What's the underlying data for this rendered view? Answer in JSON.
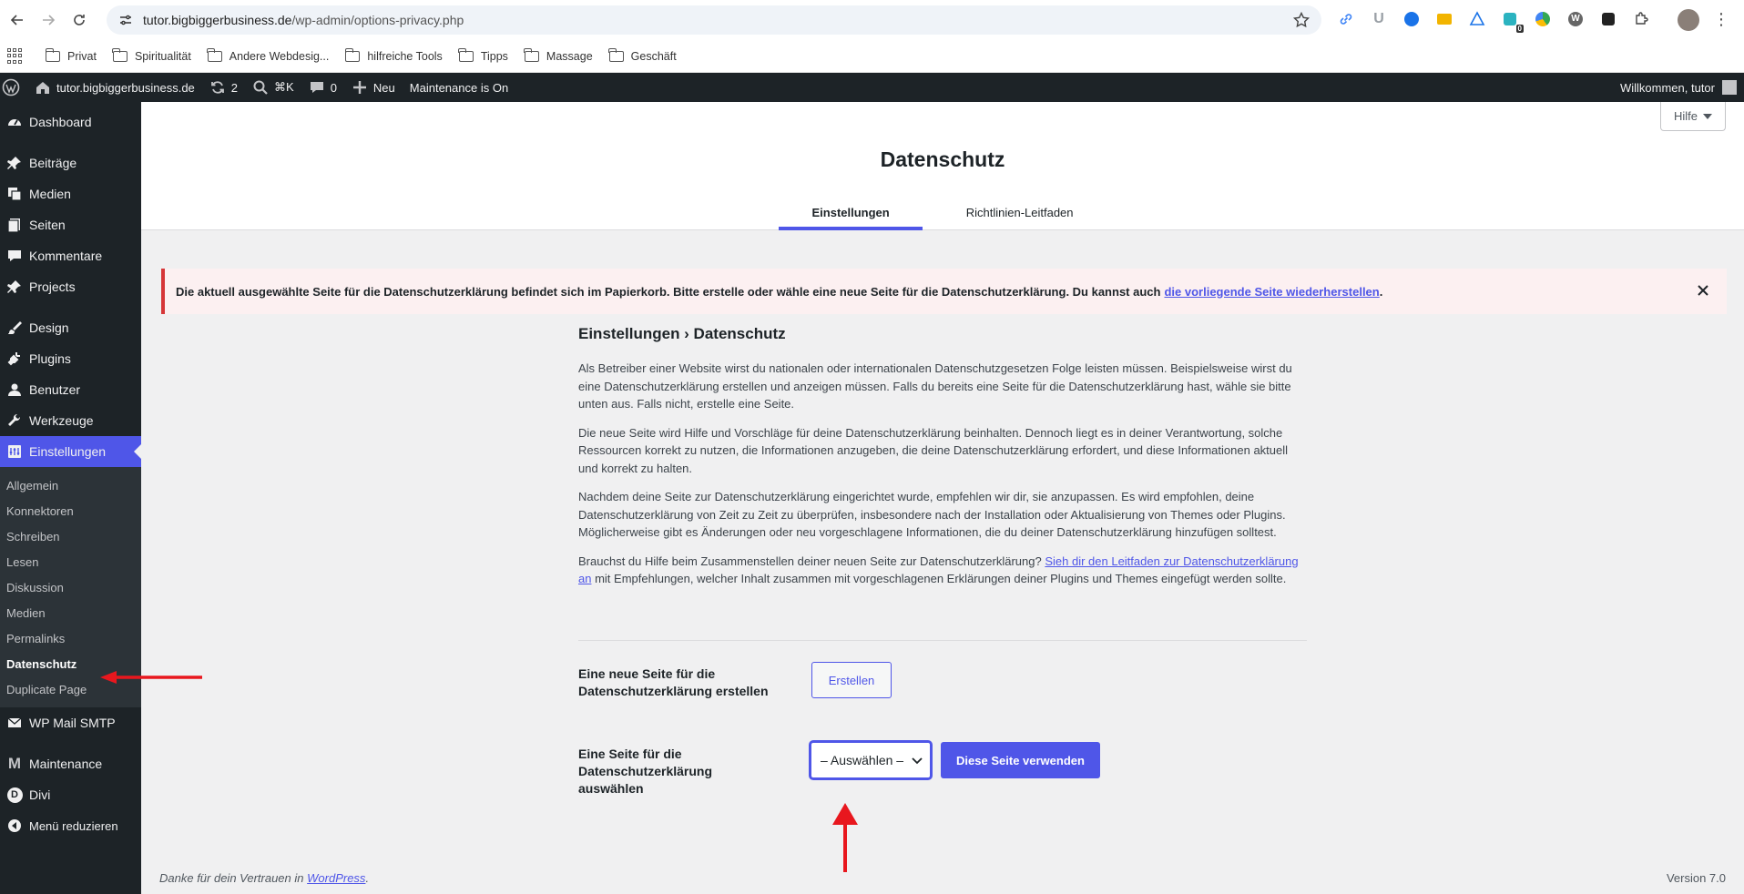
{
  "browser": {
    "url_host": "tutor.bigbiggerbusiness.de",
    "url_path": "/wp-admin/options-privacy.php",
    "bookmarks": [
      "Privat",
      "Spiritualität",
      "Andere Webdesig...",
      "hilfreiche Tools",
      "Tipps",
      "Massage",
      "Geschäft"
    ],
    "extension_badge": "0"
  },
  "adminbar": {
    "site_name": "tutor.bigbiggerbusiness.de",
    "updates_count": "2",
    "search_shortcut": "⌘K",
    "comments_count": "0",
    "new_label": "Neu",
    "maintenance_label": "Maintenance is On",
    "welcome": "Willkommen, tutor"
  },
  "sidebar": {
    "items": [
      {
        "label": "Dashboard",
        "icon": "dashboard-icon"
      },
      {
        "label": "Beiträge",
        "icon": "pin-icon"
      },
      {
        "label": "Medien",
        "icon": "media-icon"
      },
      {
        "label": "Seiten",
        "icon": "pages-icon"
      },
      {
        "label": "Kommentare",
        "icon": "comment-icon"
      },
      {
        "label": "Projects",
        "icon": "pin-icon"
      },
      {
        "label": "Design",
        "icon": "brush-icon"
      },
      {
        "label": "Plugins",
        "icon": "plug-icon"
      },
      {
        "label": "Benutzer",
        "icon": "user-icon"
      },
      {
        "label": "Werkzeuge",
        "icon": "wrench-icon"
      },
      {
        "label": "Einstellungen",
        "icon": "settings-icon"
      }
    ],
    "submenu": [
      "Allgemein",
      "Konnektoren",
      "Schreiben",
      "Lesen",
      "Diskussion",
      "Medien",
      "Permalinks",
      "Datenschutz",
      "Duplicate Page"
    ],
    "after": [
      {
        "label": "WP Mail SMTP",
        "icon": "mail-icon"
      },
      {
        "label": "Maintenance",
        "icon": "maintenance-icon"
      },
      {
        "label": "Divi",
        "icon": "divi-icon"
      },
      {
        "label": "Menü reduzieren",
        "icon": "collapse-icon"
      }
    ]
  },
  "header": {
    "help_label": "Hilfe",
    "title": "Datenschutz",
    "tabs": [
      "Einstellungen",
      "Richtlinien-Leitfaden"
    ]
  },
  "notice": {
    "text": "Die aktuell ausgewählte Seite für die Datenschutzerklärung befindet sich im Papierkorb. Bitte erstelle oder wähle eine neue Seite für die Datenschutzerklärung. Du kannst auch",
    "link": "die vorliegende Seite wiederherstellen",
    "end": "."
  },
  "main": {
    "heading": "Einstellungen › Datenschutz",
    "p1": "Als Betreiber einer Website wirst du nationalen oder internationalen Datenschutzgesetzen Folge leisten müssen. Beispielsweise wirst du eine Datenschutzerklärung erstellen und anzeigen müssen. Falls du bereits eine Seite für die Datenschutzerklärung hast, wähle sie bitte unten aus. Falls nicht, erstelle eine Seite.",
    "p2": "Die neue Seite wird Hilfe und Vorschläge für deine Datenschutzerklärung beinhalten. Dennoch liegt es in deiner Verantwortung, solche Ressourcen korrekt zu nutzen, die Informationen anzugeben, die deine Datenschutzerklärung erfordert, und diese Informationen aktuell und korrekt zu halten.",
    "p3": "Nachdem deine Seite zur Datenschutzerklärung eingerichtet wurde, empfehlen wir dir, sie anzupassen. Es wird empfohlen, deine Datenschutzerklärung von Zeit zu Zeit zu überprüfen, insbesondere nach der Installation oder Aktualisierung von Themes oder Plugins. Möglicherweise gibt es Änderungen oder neu vorgeschlagene Informationen, die du deiner Datenschutzerklärung hinzufügen solltest.",
    "p4_start": "Brauchst du Hilfe beim Zusammenstellen deiner neuen Seite zur Datenschutzerklärung?",
    "p4_link": "Sieh dir den Leitfaden zur Datenschutzerklärung an",
    "p4_end": "mit Empfehlungen, welcher Inhalt zusammen mit vorgeschlagenen Erklärungen deiner Plugins und Themes eingefügt werden sollte.",
    "create_label": "Eine neue Seite für die Datenschutzerklärung erstellen",
    "create_button": "Erstellen",
    "select_label": "Eine Seite für die Datenschutzerklärung auswählen",
    "select_value": "– Auswählen –",
    "use_button": "Diese Seite verwenden"
  },
  "footer": {
    "thanks": "Danke für dein Vertrauen in",
    "wp_link": "WordPress",
    "end": ".",
    "version": "Version 7.0"
  },
  "colors": {
    "accent": "#4f56e8",
    "adminbar": "#1d2327",
    "notice_border": "#d63638",
    "annotation_arrow": "#e8171e"
  }
}
